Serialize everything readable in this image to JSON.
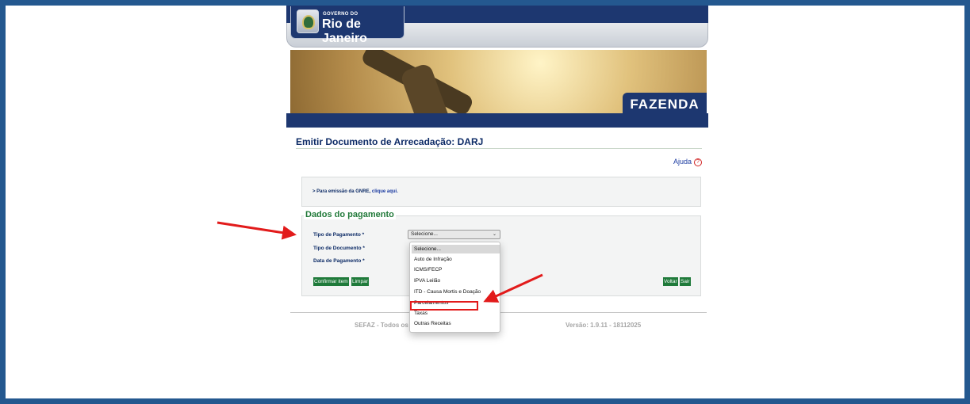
{
  "header": {
    "logo_line1": "GOVERNO DO",
    "logo_line2": "Rio de Janeiro",
    "banner_label": "FAZENDA"
  },
  "page": {
    "title": "Emitir Documento de Arrecadação: DARJ",
    "help_label": "Ajuda",
    "gnre_text": "> Para emissão da GNRE, ",
    "gnre_link": "clique aqui."
  },
  "form": {
    "legend": "Dados do pagamento",
    "tipo_pagamento_label": "Tipo de Pagamento *",
    "tipo_documento_label": "Tipo de Documento *",
    "data_pagamento_label": "Data de Pagamento *",
    "select_value": "Selecione...",
    "buttons": {
      "confirmar": "Confirmar item",
      "limpar": "Limpar",
      "voltar": "Voltar",
      "sair": "Sair"
    }
  },
  "dropdown": {
    "options": [
      "Selecione...",
      "Auto de Infração",
      "ICMS/FECP",
      "IPVA Leilão",
      "ITD - Causa Mortis e Doação",
      "Parcelamentos",
      "Taxas",
      "Outras Receitas"
    ],
    "highlighted_option": "Parcelamentos"
  },
  "footer": {
    "left": "SEFAZ - Todos os",
    "right": "Versão: 1.9.11 - 18112025"
  },
  "colors": {
    "frame": "#24588f",
    "navy": "#1d3770",
    "legend_green": "#227a3a",
    "button_green": "#1f7a3a",
    "annotation_red": "#e21b1b"
  }
}
